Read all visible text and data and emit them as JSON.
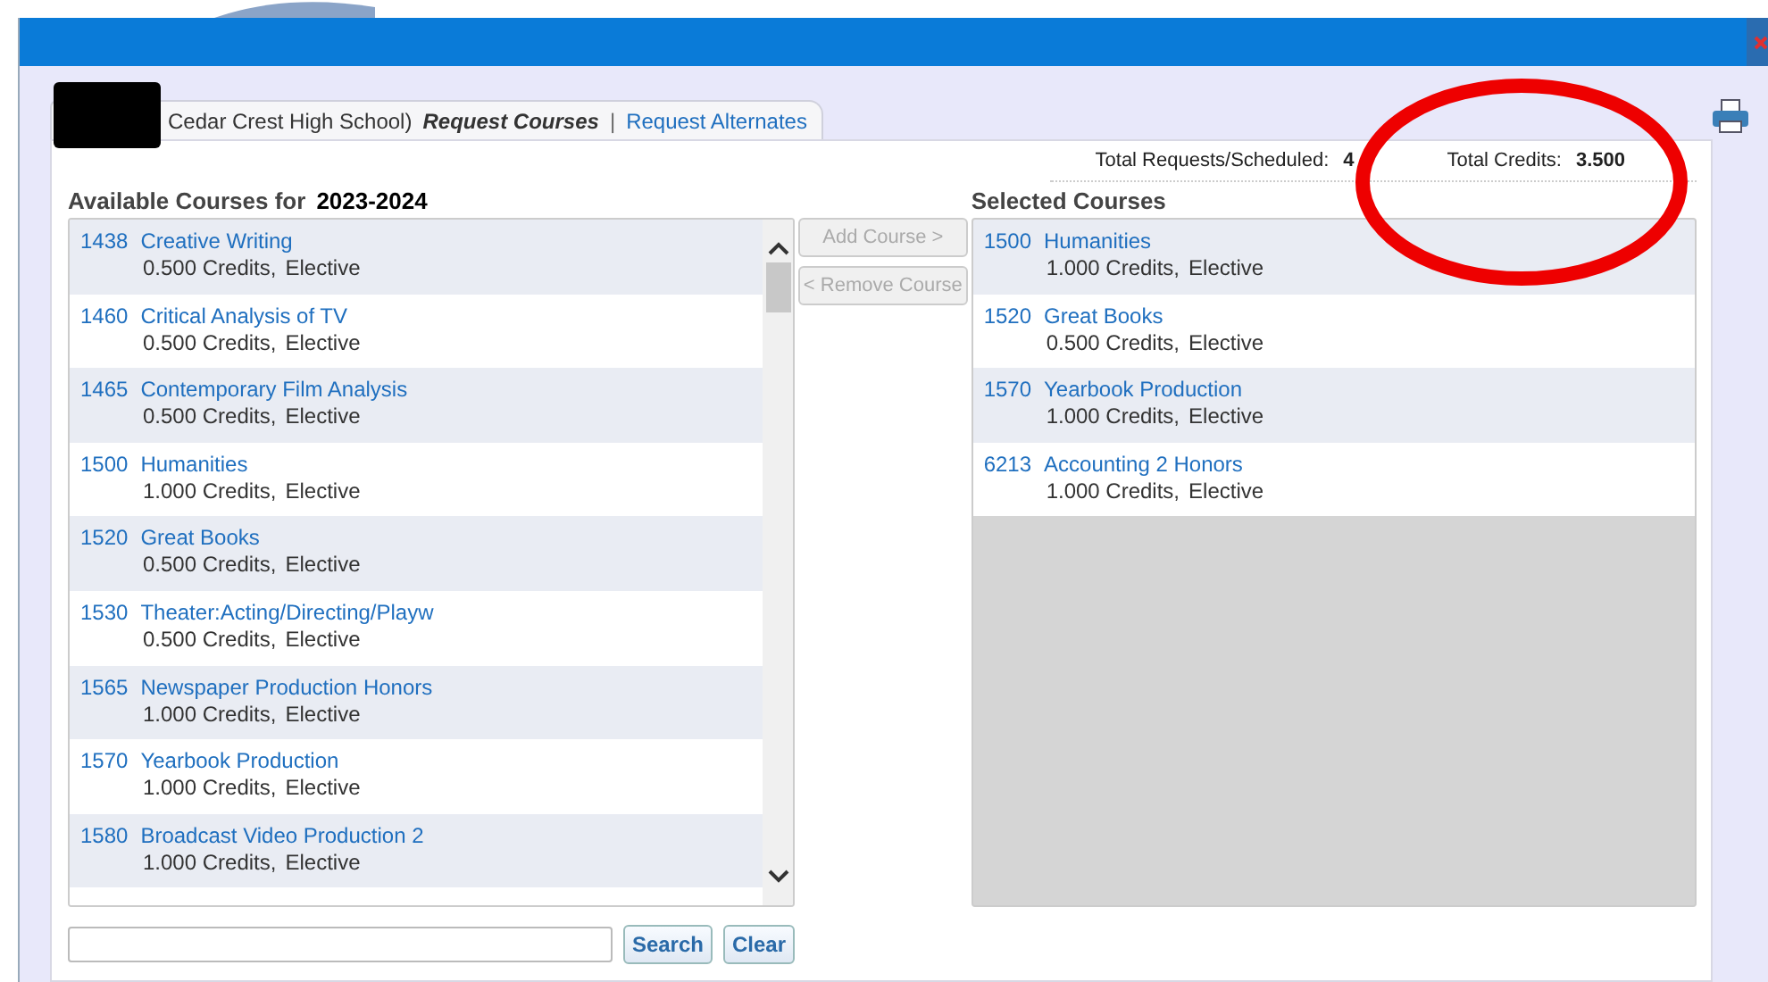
{
  "header": {
    "school_text": "Cedar Crest High School)",
    "separator": "|",
    "tabs": [
      {
        "label": "Request Courses",
        "selected": true
      },
      {
        "label": "Request Alternates",
        "selected": false
      }
    ]
  },
  "totals": {
    "requests_label": "Total Requests/Scheduled:",
    "requests_value": "4",
    "credits_label": "Total Credits:",
    "credits_value": "3.500"
  },
  "available": {
    "heading": "Available Courses for",
    "year": "2023-2024",
    "courses": [
      {
        "code": "1438",
        "name": "Creative Writing",
        "credits": "0.500 Credits,",
        "type": "Elective"
      },
      {
        "code": "1460",
        "name": "Critical Analysis of TV",
        "credits": "0.500 Credits,",
        "type": "Elective"
      },
      {
        "code": "1465",
        "name": "Contemporary Film Analysis",
        "credits": "0.500 Credits,",
        "type": "Elective"
      },
      {
        "code": "1500",
        "name": "Humanities",
        "credits": "1.000 Credits,",
        "type": "Elective"
      },
      {
        "code": "1520",
        "name": "Great Books",
        "credits": "0.500 Credits,",
        "type": "Elective"
      },
      {
        "code": "1530",
        "name": "Theater:Acting/Directing/Playw",
        "credits": "0.500 Credits,",
        "type": "Elective"
      },
      {
        "code": "1565",
        "name": "Newspaper Production Honors",
        "credits": "1.000 Credits,",
        "type": "Elective"
      },
      {
        "code": "1570",
        "name": "Yearbook Production",
        "credits": "1.000 Credits,",
        "type": "Elective"
      },
      {
        "code": "1580",
        "name": "Broadcast Video Production 2",
        "credits": "1.000 Credits,",
        "type": "Elective"
      }
    ]
  },
  "actions": [
    {
      "label": "Add Course >",
      "disabled": true
    },
    {
      "label": "< Remove Course",
      "disabled": true
    }
  ],
  "selected": {
    "heading": "Selected Courses",
    "courses": [
      {
        "code": "1500",
        "name": "Humanities",
        "credits": "1.000 Credits,",
        "type": "Elective"
      },
      {
        "code": "1520",
        "name": "Great Books",
        "credits": "0.500 Credits,",
        "type": "Elective"
      },
      {
        "code": "1570",
        "name": "Yearbook Production",
        "credits": "1.000 Credits,",
        "type": "Elective"
      },
      {
        "code": "6213",
        "name": "Accounting 2 Honors",
        "credits": "1.000 Credits,",
        "type": "Elective"
      }
    ]
  },
  "search": {
    "buttons": [
      "Search",
      "Clear"
    ]
  }
}
